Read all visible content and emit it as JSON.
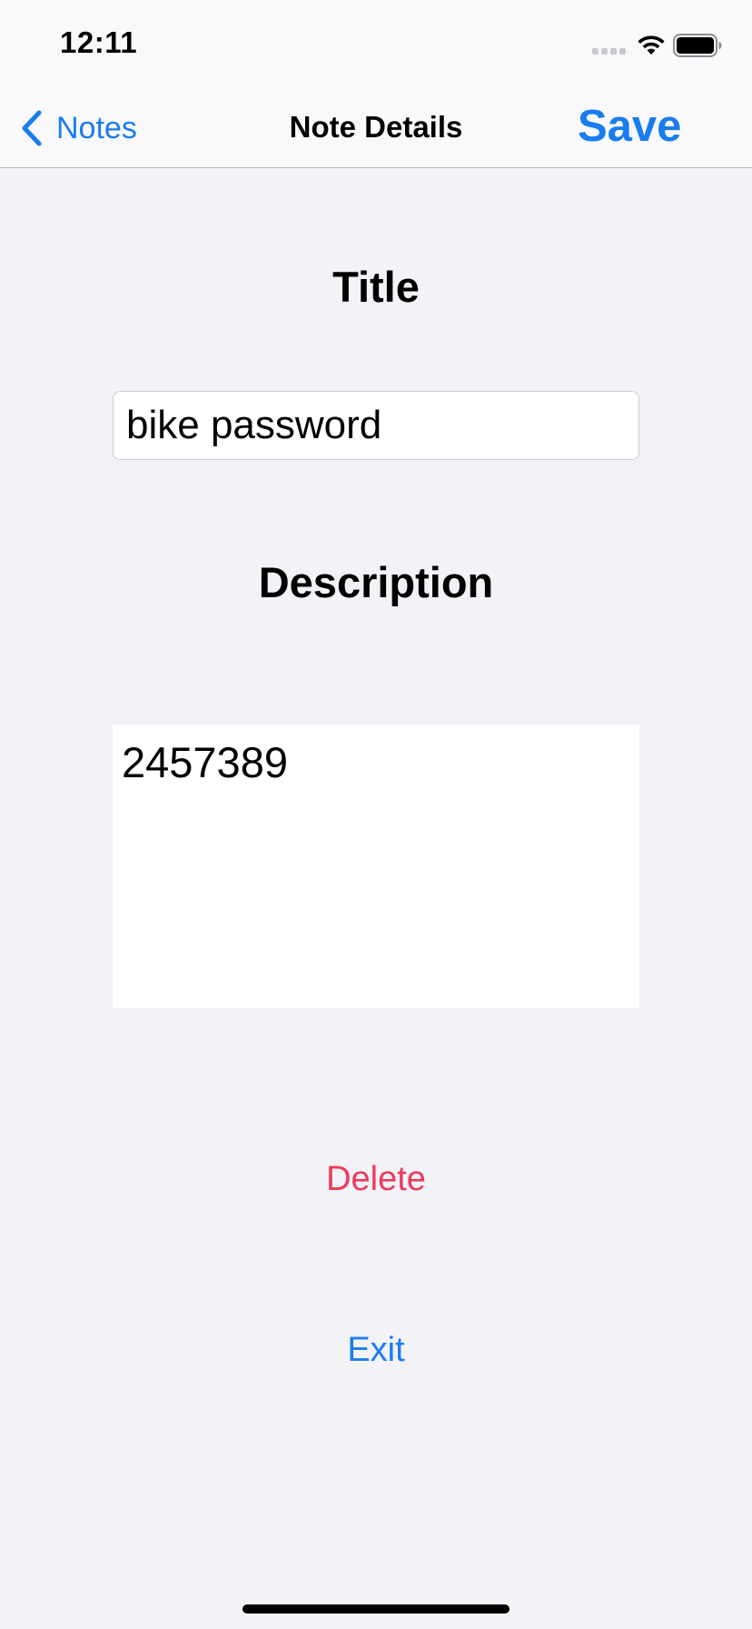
{
  "status_bar": {
    "time": "12:11"
  },
  "nav": {
    "back_label": "Notes",
    "title": "Note Details",
    "save_label": "Save"
  },
  "form": {
    "title_heading": "Title",
    "title_value": "bike password",
    "description_heading": "Description",
    "description_value": "2457389"
  },
  "actions": {
    "delete_label": "Delete",
    "exit_label": "Exit"
  },
  "icons": {
    "back": "chevron-left-icon",
    "signal": "cellular-signal-icon",
    "wifi": "wifi-icon",
    "battery": "battery-icon"
  },
  "colors": {
    "accent": "#1a7cf0",
    "destructive": "#ec3b5d",
    "background": "#f2f2f7",
    "bar_background": "#f9f9fb"
  }
}
